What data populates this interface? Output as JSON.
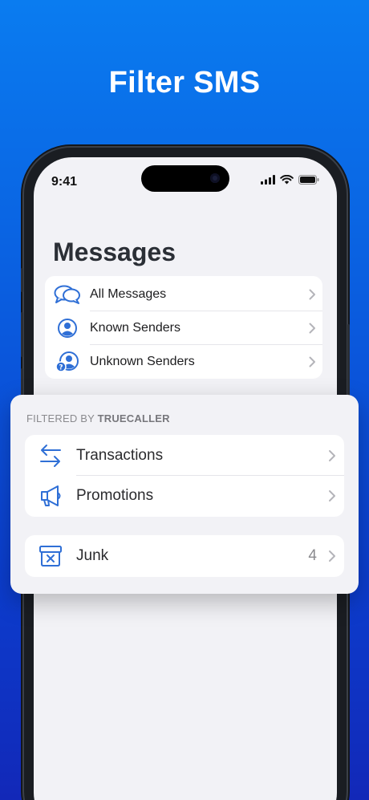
{
  "headline": "Filter SMS",
  "status_bar": {
    "time": "9:41"
  },
  "screen": {
    "title": "Messages",
    "list": [
      {
        "label": "All Messages",
        "icon": "chat-bubbles-icon"
      },
      {
        "label": "Known Senders",
        "icon": "person-circle-icon"
      },
      {
        "label": "Unknown Senders",
        "icon": "unknown-person-icon"
      }
    ]
  },
  "filtered": {
    "header_prefix": "FILTERED BY",
    "header_brand": "TRUECALLER",
    "items": [
      {
        "label": "Transactions",
        "icon": "arrows-swap-icon"
      },
      {
        "label": "Promotions",
        "icon": "megaphone-icon"
      }
    ],
    "junk": {
      "label": "Junk",
      "count": "4",
      "icon": "junk-box-icon"
    }
  },
  "colors": {
    "accent": "#2f6fd6",
    "background_top": "#0a7cf0",
    "background_bottom": "#1228b8"
  }
}
